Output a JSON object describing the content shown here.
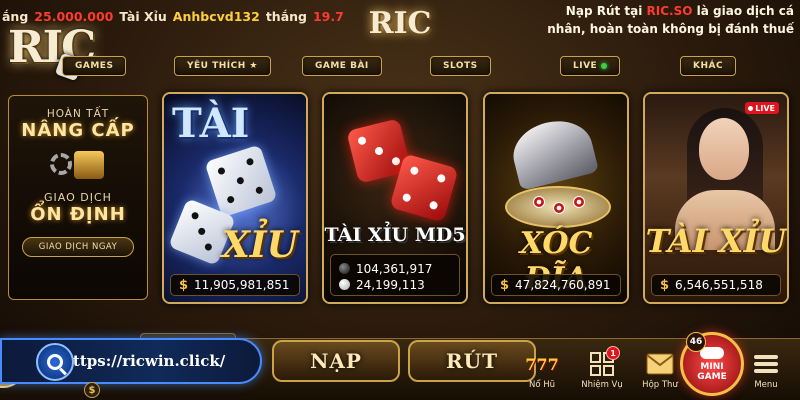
{
  "ticker": {
    "prefix": "ắng",
    "amount": "25.000.000",
    "game": "Tài Xỉu",
    "user": "Anhbcvd132",
    "verb": "thắng",
    "amount2": "19.7"
  },
  "promo": {
    "line_a": "Nạp Rút tại ",
    "brand": "RIC.SO",
    "line_b": " là giao dịch cá nhân, hoàn toàn không bị đánh thuế"
  },
  "logos": {
    "main": "RIC",
    "center": "RIC"
  },
  "tabs": [
    {
      "label": "GAMES"
    },
    {
      "label": "YÊU THÍCH ★"
    },
    {
      "label": "GAME BÀI"
    },
    {
      "label": "SLOTS"
    },
    {
      "label": "LIVE"
    },
    {
      "label": "KHÁC"
    }
  ],
  "side_panel": {
    "line1": "HOÀN TẤT",
    "line2": "NÂNG CẤP",
    "line3": "GIAO DỊCH",
    "line4": "ỔN ĐỊNH",
    "button": "GIAO DỊCH NGAY"
  },
  "games": [
    {
      "title_top": "TÀI",
      "title_bottom": "XỈU",
      "jackpot": "11,905,981,851",
      "currency": "$"
    },
    {
      "title": "TÀI XỈU MD5",
      "values": [
        "104,361,917",
        "24,199,113"
      ]
    },
    {
      "title": "XÓC ĐĨA",
      "jackpot": "47,824,760,891",
      "currency": "$"
    },
    {
      "title": "TÀI XỈU",
      "jackpot": "6,546,551,518",
      "currency": "$",
      "live": "LIVE"
    }
  ],
  "bottom": {
    "url": "https://ricwin.click/",
    "coin": "$",
    "deposit": "NẠP",
    "withdraw": "RÚT",
    "nav": [
      {
        "label": "Nổ Hũ",
        "icon": "777-icon"
      },
      {
        "label": "Nhiệm Vụ",
        "icon": "tasks-icon",
        "badge": "1"
      },
      {
        "label": "Hộp Thư",
        "icon": "mail-icon"
      },
      {
        "label": "Menu",
        "icon": "menu-icon"
      }
    ],
    "mini_game": {
      "count": "46",
      "line1": "MINI",
      "line2": "GAME"
    }
  },
  "colors": {
    "gold": "#c9a24a",
    "red": "#ff3a2e",
    "name_yellow": "#ffcf3a",
    "url_blue": "#4a8aff"
  }
}
